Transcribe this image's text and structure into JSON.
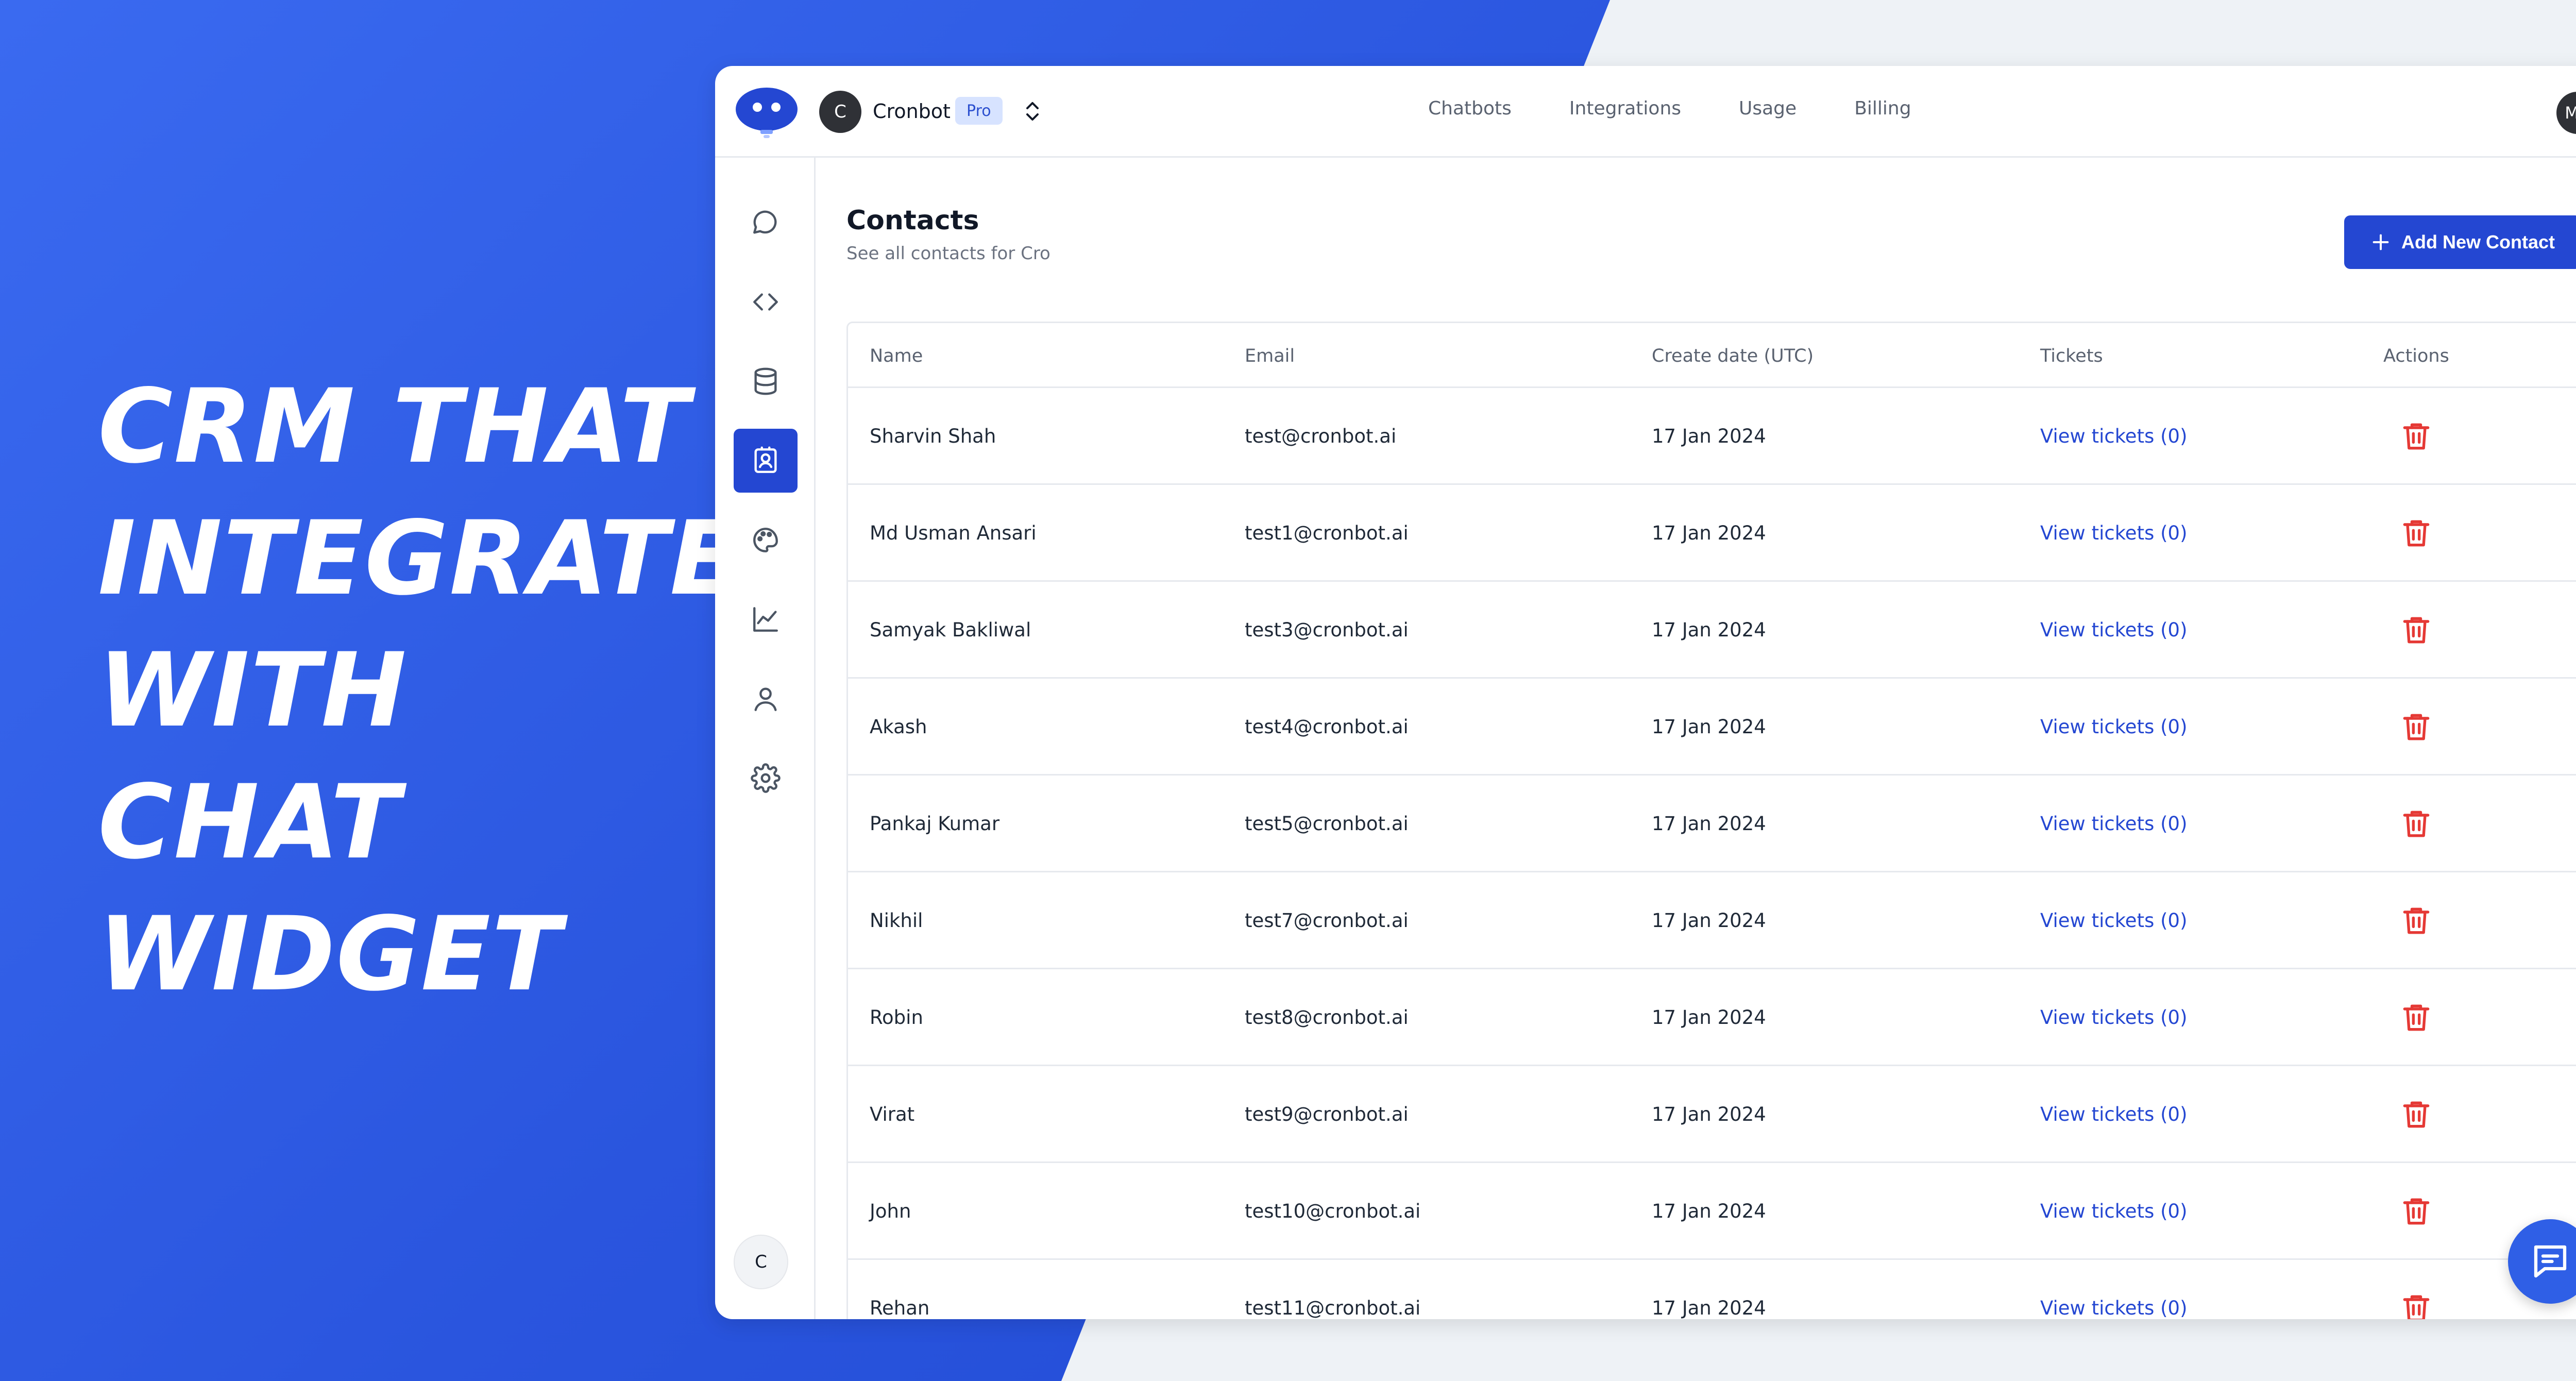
{
  "headline": [
    "CRM THAT",
    "INTEGRATE",
    "WITH",
    "CHAT",
    "WIDGET"
  ],
  "workspace": {
    "avatar_letter": "C",
    "name": "Cronbot",
    "plan": "Pro"
  },
  "nav": [
    "Chatbots",
    "Integrations",
    "Usage",
    "Billing"
  ],
  "user": {
    "initials": "MA"
  },
  "sidebar": {
    "items": [
      "chat-icon",
      "code-icon",
      "database-icon",
      "contacts-icon",
      "palette-icon",
      "chart-icon",
      "user-icon",
      "gear-icon"
    ],
    "active_index": 3,
    "bottom_letter": "C"
  },
  "page": {
    "title": "Contacts",
    "subtitle": "See all contacts for Cro",
    "add_button": "Add New Contact"
  },
  "table": {
    "headers": [
      "Name",
      "Email",
      "Create date (UTC)",
      "Tickets",
      "Actions"
    ],
    "rows": [
      {
        "name": "Sharvin Shah",
        "email": "test@cronbot.ai",
        "date": "17 Jan 2024",
        "tickets": "View tickets (0)"
      },
      {
        "name": "Md Usman Ansari",
        "email": "test1@cronbot.ai",
        "date": "17 Jan 2024",
        "tickets": "View tickets (0)"
      },
      {
        "name": "Samyak Bakliwal",
        "email": "test3@cronbot.ai",
        "date": "17 Jan 2024",
        "tickets": "View tickets (0)"
      },
      {
        "name": "Akash",
        "email": "test4@cronbot.ai",
        "date": "17 Jan 2024",
        "tickets": "View tickets (0)"
      },
      {
        "name": "Pankaj Kumar",
        "email": "test5@cronbot.ai",
        "date": "17 Jan 2024",
        "tickets": "View tickets (0)"
      },
      {
        "name": "Nikhil",
        "email": "test7@cronbot.ai",
        "date": "17 Jan 2024",
        "tickets": "View tickets (0)"
      },
      {
        "name": "Robin",
        "email": "test8@cronbot.ai",
        "date": "17 Jan 2024",
        "tickets": "View tickets (0)"
      },
      {
        "name": "Virat",
        "email": "test9@cronbot.ai",
        "date": "17 Jan 2024",
        "tickets": "View tickets (0)"
      },
      {
        "name": "John",
        "email": "test10@cronbot.ai",
        "date": "17 Jan 2024",
        "tickets": "View tickets (0)"
      },
      {
        "name": "Rehan",
        "email": "test11@cronbot.ai",
        "date": "17 Jan 2024",
        "tickets": "View tickets (0)"
      }
    ]
  },
  "colors": {
    "brand_blue": "#2447d2",
    "delete_red": "#e53935",
    "background_blue": "#2a55de"
  }
}
